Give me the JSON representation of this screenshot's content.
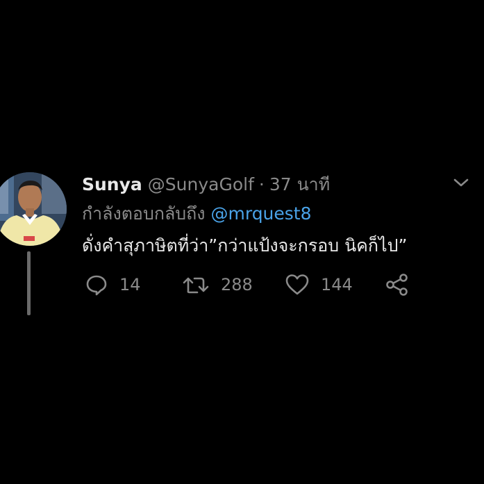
{
  "tweet": {
    "display_name": "Sunya",
    "handle": "@SunyaGolf",
    "separator": "·",
    "timestamp": "37 นาที",
    "reply_prefix": "กำลังตอบกลับถึง",
    "reply_to": "@mrquest8",
    "text": "ดั่งคำสุภาษิตที่ว่า”กว่าแป้งจะกรอบ นิคก็ไป”",
    "actions": {
      "reply_count": "14",
      "retweet_count": "288",
      "like_count": "144"
    }
  },
  "icons": {
    "avatar": "avatar",
    "menu": "chevron-down-icon",
    "reply": "reply-icon",
    "retweet": "retweet-icon",
    "like": "heart-icon",
    "share": "share-icon"
  },
  "colors": {
    "background": "#000000",
    "mention": "#4aa3e8",
    "secondary_text": "#8a8a8a",
    "primary_text": "#e8e8e8"
  }
}
